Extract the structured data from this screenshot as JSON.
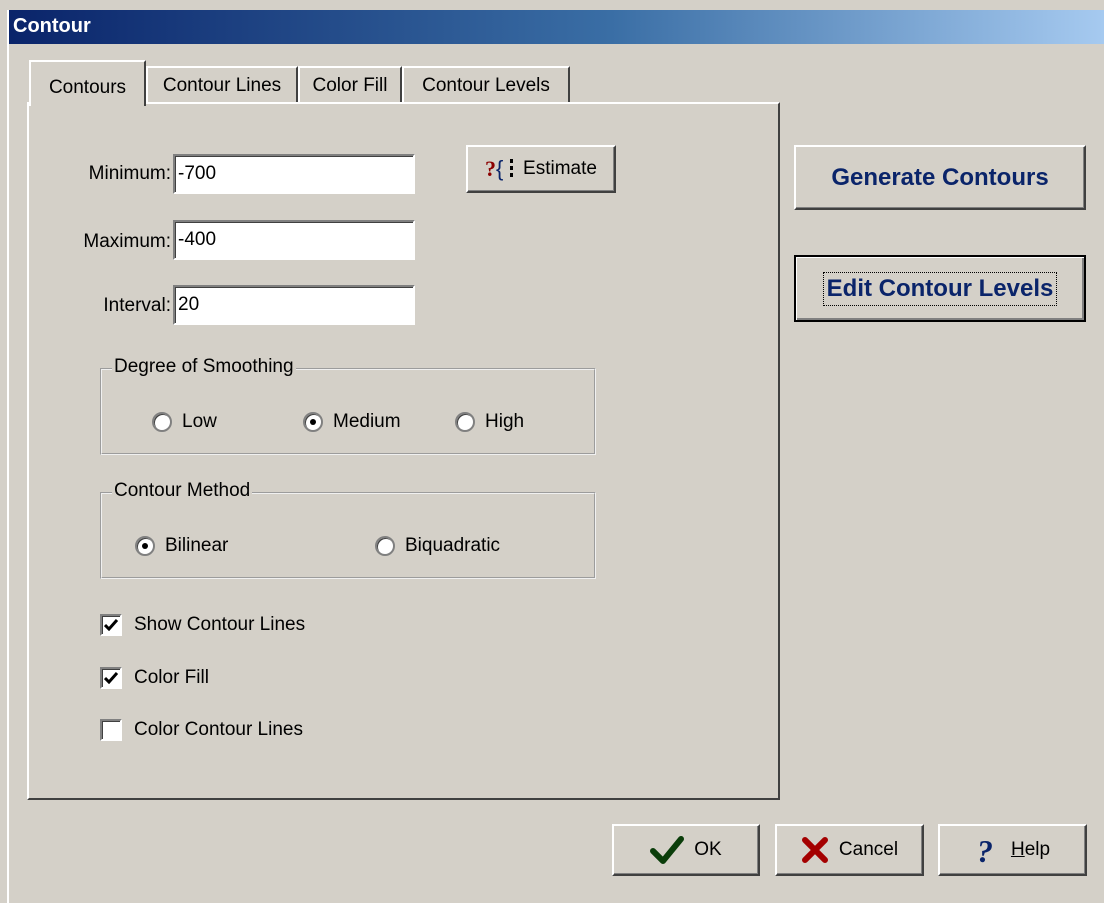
{
  "window": {
    "title": "Contour"
  },
  "tabs": [
    {
      "label": "Contours",
      "active": true
    },
    {
      "label": "Contour Lines",
      "active": false
    },
    {
      "label": "Color Fill",
      "active": false
    },
    {
      "label": "Contour Levels",
      "active": false
    }
  ],
  "fields": {
    "minimum": {
      "label": "Minimum:",
      "value": "-700"
    },
    "maximum": {
      "label": "Maximum:",
      "value": "-400"
    },
    "interval": {
      "label": "Interval:",
      "value": "20"
    }
  },
  "estimate_button": {
    "label": "Estimate",
    "icon": "question-bracket-icon"
  },
  "smoothing": {
    "legend": "Degree of Smoothing",
    "options": [
      {
        "label": "Low",
        "selected": false
      },
      {
        "label": "Medium",
        "selected": true
      },
      {
        "label": "High",
        "selected": false
      }
    ]
  },
  "method": {
    "legend": "Contour Method",
    "options": [
      {
        "label": "Bilinear",
        "selected": true
      },
      {
        "label": "Biquadratic",
        "selected": false
      }
    ]
  },
  "checkboxes": [
    {
      "label": "Show Contour Lines",
      "checked": true
    },
    {
      "label": "Color Fill",
      "checked": true
    },
    {
      "label": "Color Contour Lines",
      "checked": false
    }
  ],
  "side_buttons": {
    "generate": "Generate Contours",
    "edit_levels": "Edit Contour Levels"
  },
  "dialog_buttons": {
    "ok": {
      "label": "OK",
      "icon": "checkmark-icon"
    },
    "cancel": {
      "label": "Cancel",
      "icon": "x-icon"
    },
    "help": {
      "label": "Help",
      "icon": "question-icon"
    }
  },
  "colors": {
    "title_start": "#0a246a",
    "title_end": "#a6caf0",
    "button_text": "#0a246a",
    "face": "#d4d0c8"
  }
}
